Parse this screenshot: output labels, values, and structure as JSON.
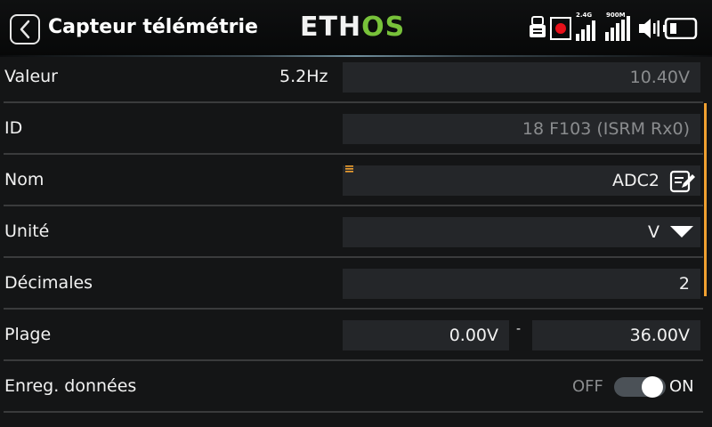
{
  "header": {
    "title": "Capteur télémétrie",
    "logo_part1": "ETH",
    "logo_part2": "OS",
    "signal_24g_label": "2.4G",
    "signal_900m_label": "900M"
  },
  "rows": {
    "valeur": {
      "label": "Valeur",
      "rate": "5.2Hz",
      "value": "10.40V"
    },
    "id": {
      "label": "ID",
      "value": "18 F103 (ISRM Rx0)"
    },
    "nom": {
      "label": "Nom",
      "value": "ADC2"
    },
    "unite": {
      "label": "Unité",
      "value": "V"
    },
    "decimales": {
      "label": "Décimales",
      "value": "2"
    },
    "plage": {
      "label": "Plage",
      "min": "0.00V",
      "separator": "-",
      "max": "36.00V"
    },
    "enreg": {
      "label": "Enreg. données",
      "off_label": "OFF",
      "on_label": "ON",
      "state": "on"
    }
  },
  "colors": {
    "accent": "#f0a030",
    "logo_green": "#78c23a",
    "record": "#e8101a",
    "field_bg": "#242629"
  },
  "icons": [
    "back-icon",
    "usb-icon",
    "record-icon",
    "signal-bars-icon",
    "volume-icon",
    "battery-icon",
    "edit-icon",
    "dropdown-arrow-icon",
    "drag-handle-icon"
  ]
}
